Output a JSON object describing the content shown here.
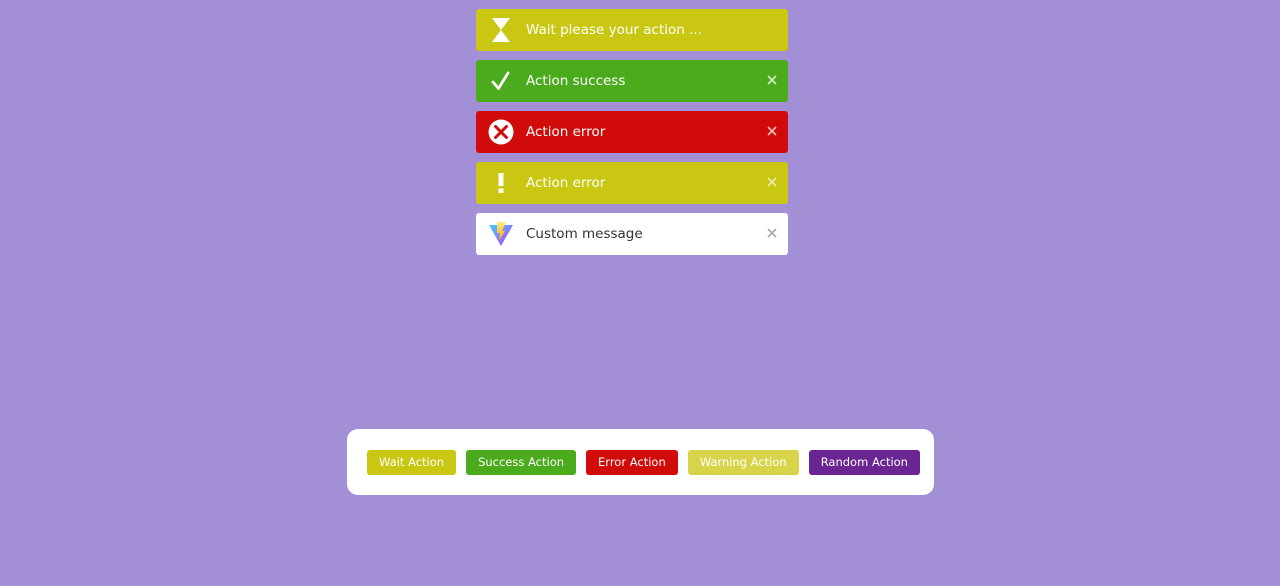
{
  "toasts": [
    {
      "message": "Wait please your action ...",
      "icon": "hourglass-icon",
      "color": "#c9c712"
    },
    {
      "message": "Action success",
      "icon": "checkmark-icon",
      "color": "#4caa1d"
    },
    {
      "message": "Action error",
      "icon": "error-circle-icon",
      "color": "#d10a0a"
    },
    {
      "message": "Action error",
      "icon": "exclamation-icon",
      "color": "#c9c712"
    },
    {
      "message": "Custom message",
      "icon": "vite-logo-icon",
      "color": "#ffffff"
    }
  ],
  "buttons": {
    "wait": "Wait Action",
    "success": "Success Action",
    "error": "Error Action",
    "warning": "Warning Action",
    "random": "Random Action"
  },
  "colors": {
    "background": "#a28fd6",
    "wait": "#c9c712",
    "success": "#4caa1d",
    "error": "#d10a0a",
    "warning": "#d8d44a",
    "random": "#6a2592"
  }
}
